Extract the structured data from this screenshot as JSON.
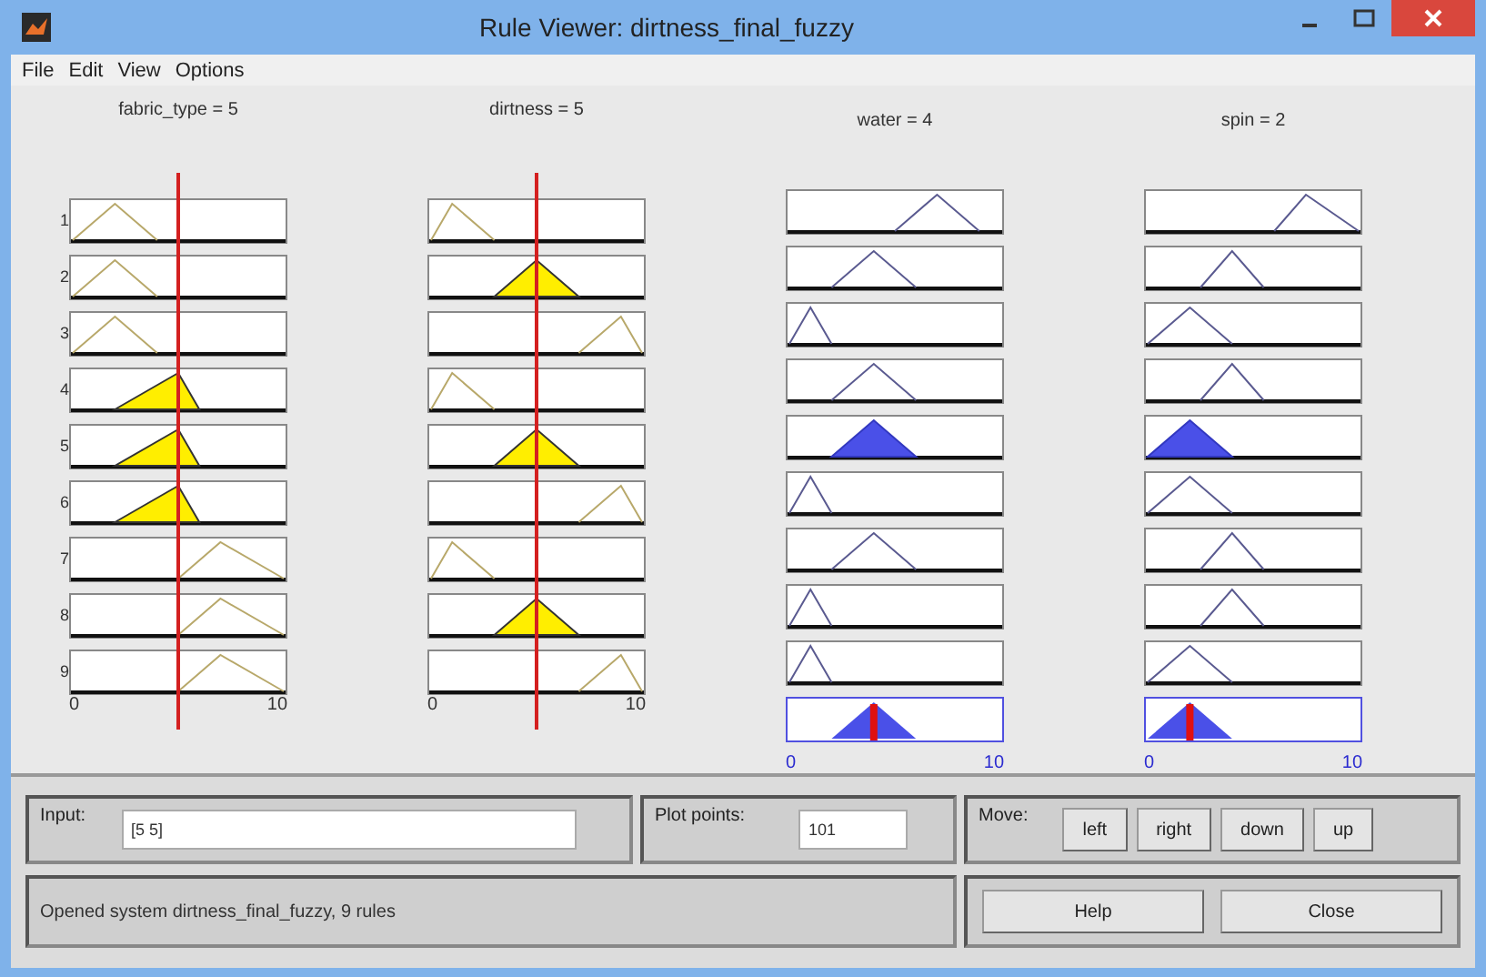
{
  "window": {
    "title": "Rule Viewer: dirtness_final_fuzzy"
  },
  "menu": [
    "File",
    "Edit",
    "View",
    "Options"
  ],
  "rule_numbers": [
    "1",
    "2",
    "3",
    "4",
    "5",
    "6",
    "7",
    "8",
    "9"
  ],
  "inputs": [
    {
      "label": "fabric_type = 5",
      "tick_min": "0",
      "tick_max": "10",
      "rules": [
        {
          "fired": false
        },
        {
          "fired": false
        },
        {
          "fired": false
        },
        {
          "fired": true
        },
        {
          "fired": true
        },
        {
          "fired": true
        },
        {
          "fired": false
        },
        {
          "fired": false
        },
        {
          "fired": false
        }
      ]
    },
    {
      "label": "dirtness = 5",
      "tick_min": "0",
      "tick_max": "10",
      "rules": [
        {
          "fired": false
        },
        {
          "fired": true
        },
        {
          "fired": false
        },
        {
          "fired": false
        },
        {
          "fired": true
        },
        {
          "fired": false
        },
        {
          "fired": false
        },
        {
          "fired": true
        },
        {
          "fired": false
        }
      ]
    }
  ],
  "outputs": [
    {
      "label": "water = 4",
      "tick_min": "0",
      "tick_max": "10",
      "rules": [
        {
          "fired": false
        },
        {
          "fired": false
        },
        {
          "fired": false
        },
        {
          "fired": false
        },
        {
          "fired": true
        },
        {
          "fired": false
        },
        {
          "fired": false
        },
        {
          "fired": false
        },
        {
          "fired": false
        }
      ]
    },
    {
      "label": "spin = 2",
      "tick_min": "0",
      "tick_max": "10",
      "rules": [
        {
          "fired": false
        },
        {
          "fired": false
        },
        {
          "fired": false
        },
        {
          "fired": false
        },
        {
          "fired": true
        },
        {
          "fired": false
        },
        {
          "fired": false
        },
        {
          "fired": false
        },
        {
          "fired": false
        }
      ]
    }
  ],
  "input_field": {
    "label": "Input:",
    "value": "[5 5]"
  },
  "plot_points": {
    "label": "Plot points:",
    "value": "101"
  },
  "move": {
    "label": "Move:",
    "buttons": [
      "left",
      "right",
      "down",
      "up"
    ]
  },
  "status": "Opened system dirtness_final_fuzzy, 9 rules",
  "buttons": [
    "Help",
    "Close"
  ]
}
